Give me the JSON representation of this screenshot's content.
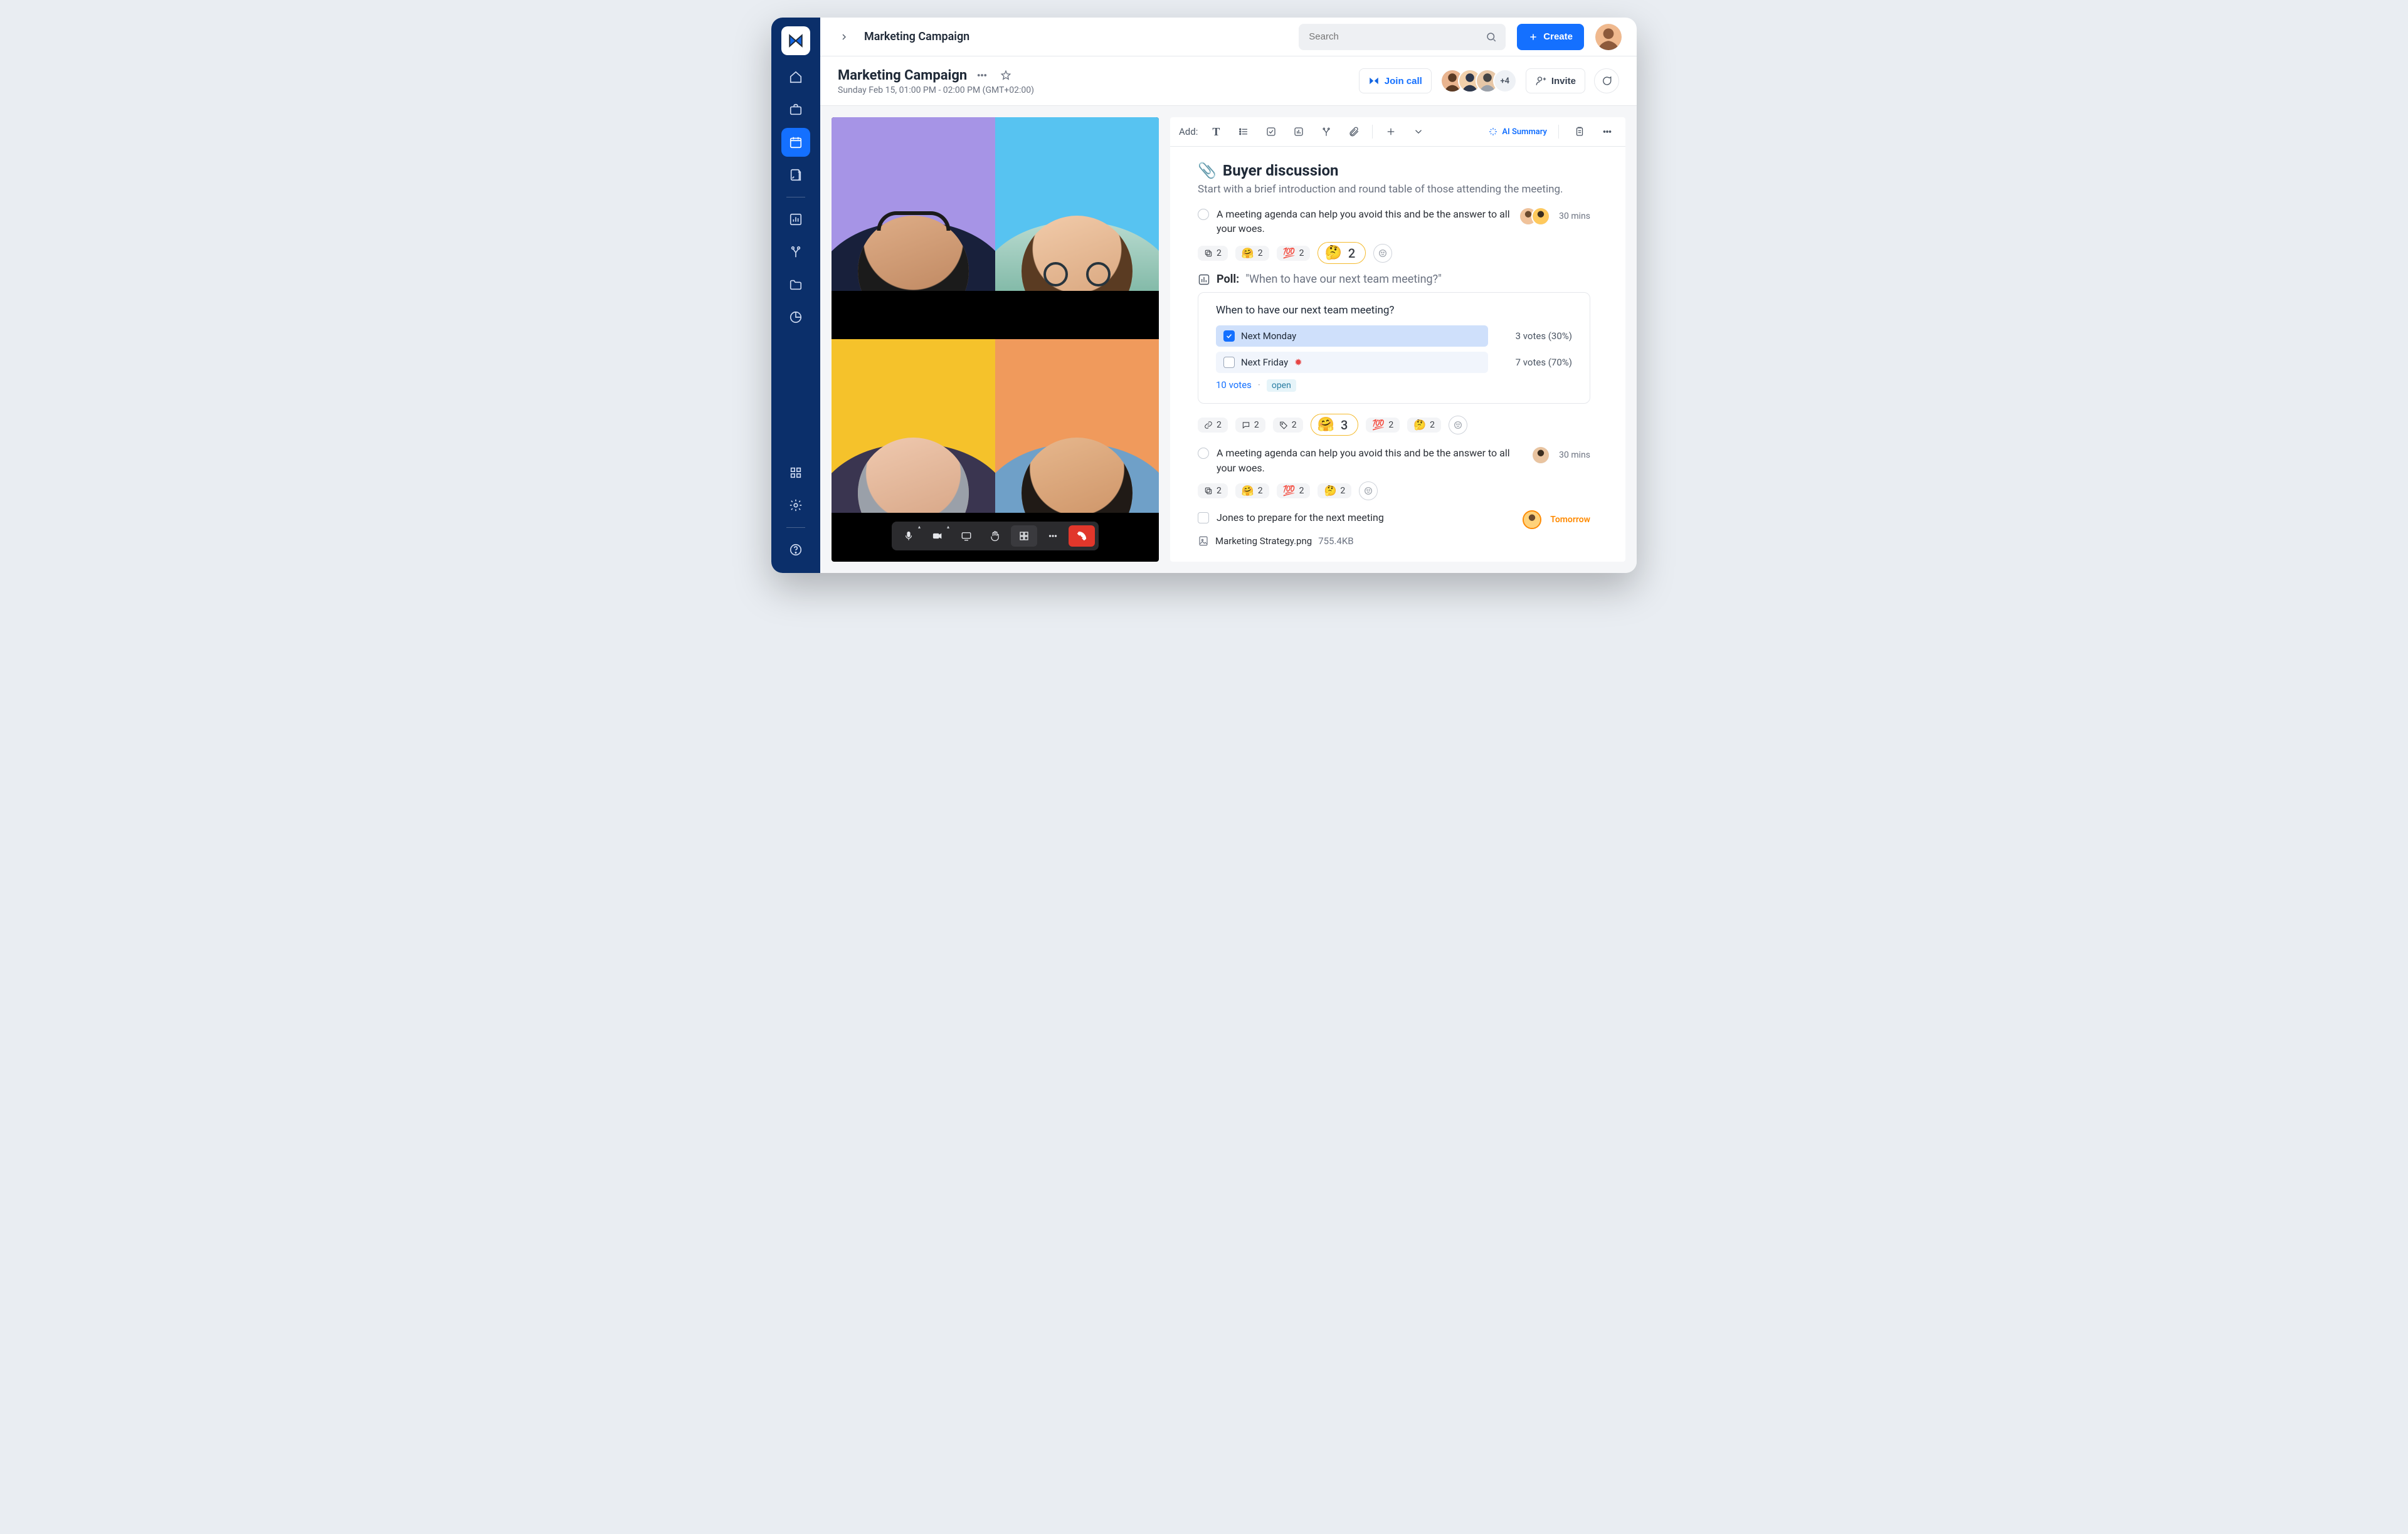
{
  "header": {
    "breadcrumb": "Marketing Campaign",
    "search_placeholder": "Search",
    "create_label": "Create"
  },
  "page": {
    "title": "Marketing Campaign",
    "datetime": "Sunday Feb 15, 01:00 PM - 02:00 PM (GMT+02:00)",
    "join_call_label": "Join call",
    "invite_label": "Invite",
    "extra_count": "+4"
  },
  "doc_toolbar": {
    "add_label": "Add:",
    "ai_summary_label": "AI Summary"
  },
  "doc": {
    "section_emoji": "📎",
    "section_title": "Buyer discussion",
    "intro": "Start with a brief introduction and round table of those attending the meeting.",
    "agenda_item_1": "A meeting agenda can help you avoid this and be the answer to all your woes.",
    "agenda_item_1_time": "30 mins",
    "agenda_item_2": "A meeting agenda can help you avoid this and be the answer to all your woes.",
    "agenda_item_2_time": "30 mins",
    "task_text": "Jones to prepare for the next meeting",
    "task_due": "Tomorrow",
    "attachment_name": "Marketing Strategy.png",
    "attachment_size": "755.4KB"
  },
  "poll": {
    "label": "Poll:",
    "question_inline": "\"When to have our next team meeting?\"",
    "question": "When to have our next team meeting?",
    "options": [
      {
        "label": "Next Monday",
        "selected": true,
        "votes_text": "3 votes (30%)"
      },
      {
        "label": "Next Friday",
        "selected": false,
        "votes_text": "7 votes (70%)",
        "flag": true
      }
    ],
    "total_votes_text": "10 votes",
    "open_label": "open"
  },
  "reactions_top": {
    "copies": "2",
    "hug": "2",
    "hundred": "2",
    "big_emoji": "🤔",
    "big_count": "2"
  },
  "reactions_bottom": {
    "link": "2",
    "comments": "2",
    "tags": "2",
    "big_emoji": "🤗",
    "big_count": "3",
    "hundred": "2",
    "think": "2"
  },
  "reactions_item2": {
    "copies": "2",
    "hug": "2",
    "hundred": "2",
    "think": "2"
  },
  "colors": {
    "tile1": "#a694e6",
    "tile2": "#57c3f1",
    "tile3": "#f5c22b",
    "tile4": "#f09a5c"
  }
}
